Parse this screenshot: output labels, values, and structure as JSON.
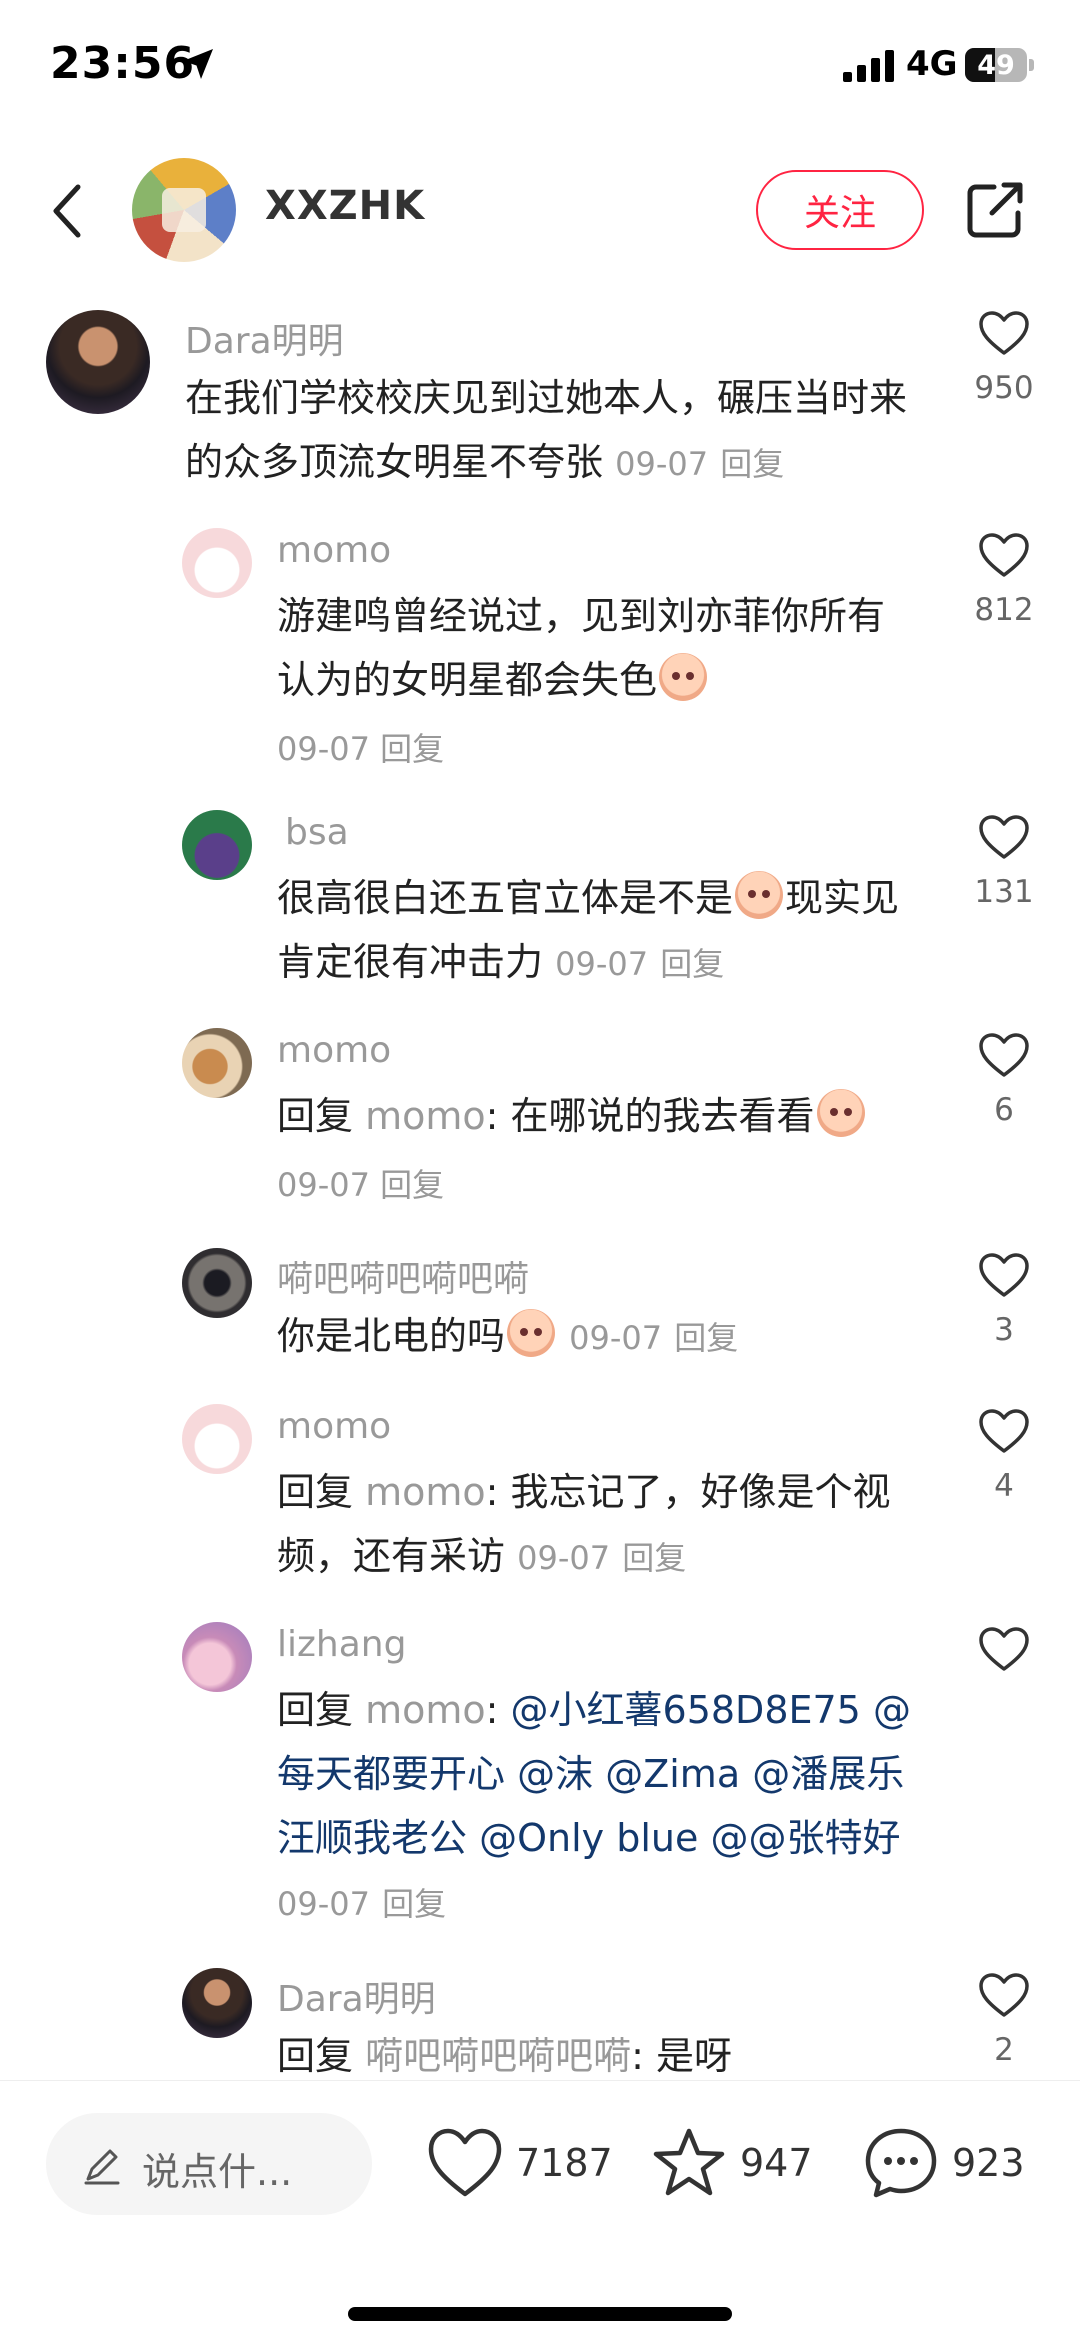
{
  "status_bar": {
    "time": "23:56",
    "network": "4G",
    "battery": "49",
    "battery_level": 0.49
  },
  "header": {
    "author": "XXZHK",
    "follow_label": "关注"
  },
  "comments": [
    {
      "user": "Dara明明",
      "text": "在我们学校校庆见到过她本人，碾压当时来的众多顶流女明星不夸张",
      "date": "09-07",
      "reply": "回复",
      "likes": "950"
    },
    {
      "user": "momo",
      "text": "游建鸣曾经说过，见到刘亦菲你所有认为的女明星都会失色",
      "date": "09-07",
      "reply": "回复",
      "likes": "812"
    },
    {
      "user": "bsa",
      "text_a": "很高很白还五官立体是不是",
      "text_b": "现实见肯定很有冲击力",
      "date": "09-07",
      "reply": "回复",
      "likes": "131"
    },
    {
      "user": "momo",
      "prefix": "回复",
      "target": "momo",
      "text": ": 在哪说的我去看看",
      "date": "09-07",
      "reply": "回复",
      "likes": "6"
    },
    {
      "user": "嗬吧嗬吧嗬吧嗬",
      "text": "你是北电的吗",
      "date": "09-07",
      "reply": "回复",
      "likes": "3"
    },
    {
      "user": "momo",
      "prefix": "回复",
      "target": "momo",
      "text": ": 我忘记了，好像是个视频，还有采访",
      "date": "09-07",
      "reply": "回复",
      "likes": "4"
    },
    {
      "user": "lizhang",
      "prefix": "回复",
      "target": "momo",
      "sep": ": ",
      "mentions": [
        "@小红薯658D8E75",
        "@每天都要开心",
        "@沫",
        "@Zima",
        "@潘展乐汪顺我老公",
        "@Only blue",
        "@",
        "@张特好"
      ],
      "date": "09-07",
      "reply": "回复"
    },
    {
      "user": "Dara明明",
      "prefix": "回复",
      "target": "嗬吧嗬吧嗬吧嗬",
      "text": ": 是呀",
      "likes": "2"
    }
  ],
  "bottom_bar": {
    "input_placeholder": "说点什...",
    "likes": "7187",
    "stars": "947",
    "comments": "923"
  },
  "colors": {
    "accent": "#ff2442",
    "mention": "#13386c",
    "meta": "#999999"
  },
  "icons": [
    "location-arrow-icon",
    "signal-icon",
    "battery-icon",
    "back-chevron-icon",
    "share-icon",
    "heart-icon",
    "pencil-icon",
    "star-icon",
    "chat-bubble-icon"
  ]
}
